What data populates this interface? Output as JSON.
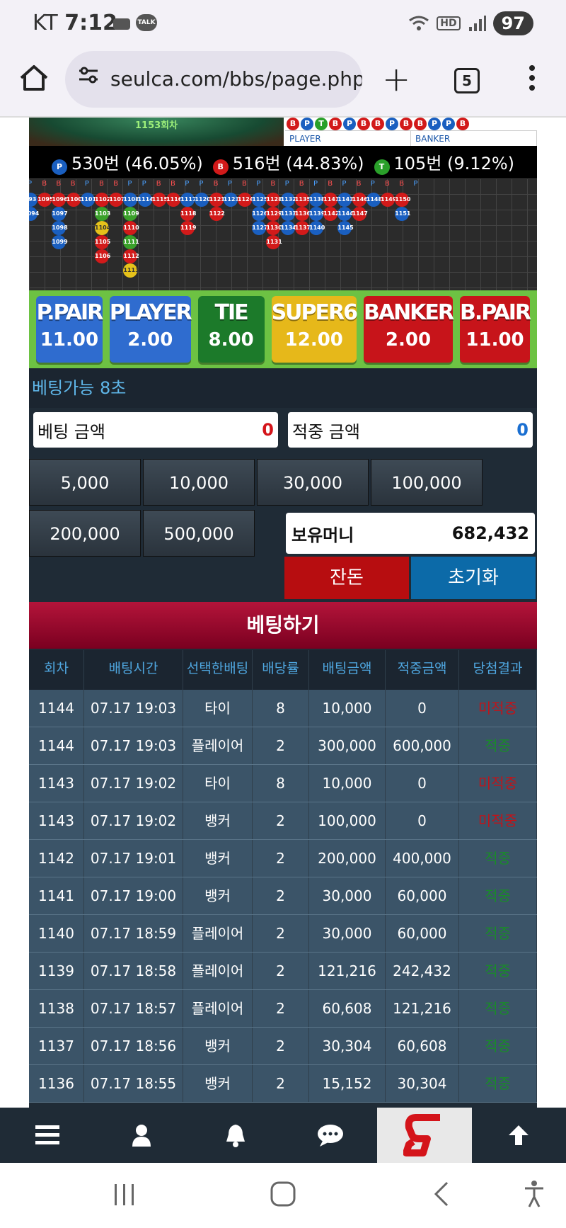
{
  "status_bar": {
    "carrier": "KT",
    "time": "7:12",
    "talk": "TALK",
    "hd": "HD",
    "battery": "97"
  },
  "browser": {
    "url": "seulca.com/bbs/page.php?",
    "tab_count": "5"
  },
  "game": {
    "round_label": "1153회차",
    "road_top": [
      "B",
      "P",
      "T",
      "B",
      "P",
      "B",
      "B",
      "P",
      "B",
      "B",
      "P",
      "P",
      "B"
    ],
    "legend": {
      "player": "PLAYER",
      "banker": "BANKER"
    },
    "stats": [
      {
        "icon": "P",
        "text": "530번 (46.05%)",
        "color": "#1a5fc0"
      },
      {
        "icon": "B",
        "text": "516번 (44.83%)",
        "color": "#d21a1a"
      },
      {
        "icon": "T",
        "text": "105번 (9.12%)",
        "color": "#2aa02a"
      }
    ],
    "history_header": [
      "P",
      "B",
      "B",
      "B",
      "P",
      "B",
      "B",
      "P",
      "P",
      "B",
      "B",
      "P",
      "P",
      "B",
      "P",
      "B",
      "P",
      "B",
      "P",
      "B",
      "P",
      "B",
      "P",
      "B",
      "P",
      "B",
      "B",
      "P"
    ],
    "history_row1": [
      "093",
      "1095",
      "1096",
      "1100",
      "1101",
      "1102",
      "1107",
      "1108",
      "1114",
      "1115",
      "1116",
      "1117",
      "1120",
      "1121",
      "1123",
      "1124",
      "1125",
      "1128",
      "1132",
      "1135",
      "1138",
      "1141",
      "1143",
      "1146",
      "1148",
      "1149",
      "1150"
    ],
    "history_extra": [
      {
        "label": "1094",
        "col": 0,
        "row": 1,
        "c": "b"
      },
      {
        "label": "1097",
        "col": 2,
        "row": 1,
        "c": "b"
      },
      {
        "label": "1098",
        "col": 2,
        "row": 2,
        "c": "b"
      },
      {
        "label": "1099",
        "col": 2,
        "row": 3,
        "c": "b"
      },
      {
        "label": "1103",
        "col": 5,
        "row": 1,
        "c": "g"
      },
      {
        "label": "1104",
        "col": 5,
        "row": 2,
        "c": "y"
      },
      {
        "label": "1105",
        "col": 5,
        "row": 3,
        "c": "r"
      },
      {
        "label": "1106",
        "col": 5,
        "row": 4,
        "c": "r"
      },
      {
        "label": "1109",
        "col": 7,
        "row": 1,
        "c": "g"
      },
      {
        "label": "1110",
        "col": 7,
        "row": 2,
        "c": "r"
      },
      {
        "label": "1111",
        "col": 7,
        "row": 3,
        "c": "g"
      },
      {
        "label": "1112",
        "col": 7,
        "row": 4,
        "c": "r"
      },
      {
        "label": "1113",
        "col": 7,
        "row": 5,
        "c": "y"
      },
      {
        "label": "1118",
        "col": 11,
        "row": 1,
        "c": "r"
      },
      {
        "label": "1119",
        "col": 11,
        "row": 2,
        "c": "r"
      },
      {
        "label": "1122",
        "col": 13,
        "row": 1,
        "c": "r"
      },
      {
        "label": "1126",
        "col": 16,
        "row": 1,
        "c": "b"
      },
      {
        "label": "1127",
        "col": 16,
        "row": 2,
        "c": "b"
      },
      {
        "label": "1129",
        "col": 17,
        "row": 1,
        "c": "r"
      },
      {
        "label": "1130",
        "col": 17,
        "row": 2,
        "c": "r"
      },
      {
        "label": "1131",
        "col": 17,
        "row": 3,
        "c": "r"
      },
      {
        "label": "1133",
        "col": 18,
        "row": 1,
        "c": "b"
      },
      {
        "label": "1134",
        "col": 18,
        "row": 2,
        "c": "b"
      },
      {
        "label": "1136",
        "col": 19,
        "row": 1,
        "c": "r"
      },
      {
        "label": "1137",
        "col": 19,
        "row": 2,
        "c": "r"
      },
      {
        "label": "1139",
        "col": 20,
        "row": 1,
        "c": "b"
      },
      {
        "label": "1140",
        "col": 20,
        "row": 2,
        "c": "b"
      },
      {
        "label": "1142",
        "col": 21,
        "row": 1,
        "c": "r"
      },
      {
        "label": "1144",
        "col": 22,
        "row": 1,
        "c": "b"
      },
      {
        "label": "1145",
        "col": 22,
        "row": 2,
        "c": "b"
      },
      {
        "label": "1147",
        "col": 23,
        "row": 1,
        "c": "r"
      },
      {
        "label": "1151",
        "col": 26,
        "row": 1,
        "c": "b"
      }
    ]
  },
  "bet_options": [
    {
      "name": "P.PAIR",
      "odds": "11.00",
      "color": "#2f6ccf"
    },
    {
      "name": "PLAYER",
      "odds": "2.00",
      "color": "#2f6ccf"
    },
    {
      "name": "TIE",
      "odds": "8.00",
      "color": "#1c7a2a"
    },
    {
      "name": "SUPER6",
      "odds": "12.00",
      "color": "#e6b81a"
    },
    {
      "name": "BANKER",
      "odds": "2.00",
      "color": "#c7141a"
    },
    {
      "name": "B.PAIR",
      "odds": "11.00",
      "color": "#c7141a"
    }
  ],
  "betting": {
    "available": "베팅가능 8초",
    "bet_amount_label": "베팅 금액",
    "bet_amount": "0",
    "win_amount_label": "적중 금액",
    "win_amount": "0",
    "chips": [
      "5,000",
      "10,000",
      "30,000",
      "100,000",
      "200,000",
      "500,000"
    ],
    "balance_label": "보유머니",
    "balance": "682,432",
    "change_label": "잔돈",
    "reset_label": "초기화",
    "place_label": "베팅하기"
  },
  "history_table": {
    "headers": [
      "회차",
      "배팅시간",
      "선택한배팅",
      "배당률",
      "배팅금액",
      "적중금액",
      "당첨결과"
    ],
    "rows": [
      [
        "1144",
        "07.17 19:03",
        "타이",
        "8",
        "10,000",
        "0",
        "미적중"
      ],
      [
        "1144",
        "07.17 19:03",
        "플레이어",
        "2",
        "300,000",
        "600,000",
        "적중"
      ],
      [
        "1143",
        "07.17 19:02",
        "타이",
        "8",
        "10,000",
        "0",
        "미적중"
      ],
      [
        "1143",
        "07.17 19:02",
        "뱅커",
        "2",
        "100,000",
        "0",
        "미적중"
      ],
      [
        "1142",
        "07.17 19:01",
        "뱅커",
        "2",
        "200,000",
        "400,000",
        "적중"
      ],
      [
        "1141",
        "07.17 19:00",
        "뱅커",
        "2",
        "30,000",
        "60,000",
        "적중"
      ],
      [
        "1140",
        "07.17 18:59",
        "플레이어",
        "2",
        "30,000",
        "60,000",
        "적중"
      ],
      [
        "1139",
        "07.17 18:58",
        "플레이어",
        "2",
        "121,216",
        "242,432",
        "적중"
      ],
      [
        "1138",
        "07.17 18:57",
        "플레이어",
        "2",
        "60,608",
        "121,216",
        "적중"
      ],
      [
        "1137",
        "07.17 18:56",
        "뱅커",
        "2",
        "30,304",
        "60,608",
        "적중"
      ],
      [
        "1136",
        "07.17 18:55",
        "뱅커",
        "2",
        "15,152",
        "30,304",
        "적중"
      ]
    ]
  },
  "bottom_nav": [
    "menu-icon",
    "user-icon",
    "bell-icon",
    "chat-icon",
    "site-logo",
    "arrow-up-icon"
  ]
}
